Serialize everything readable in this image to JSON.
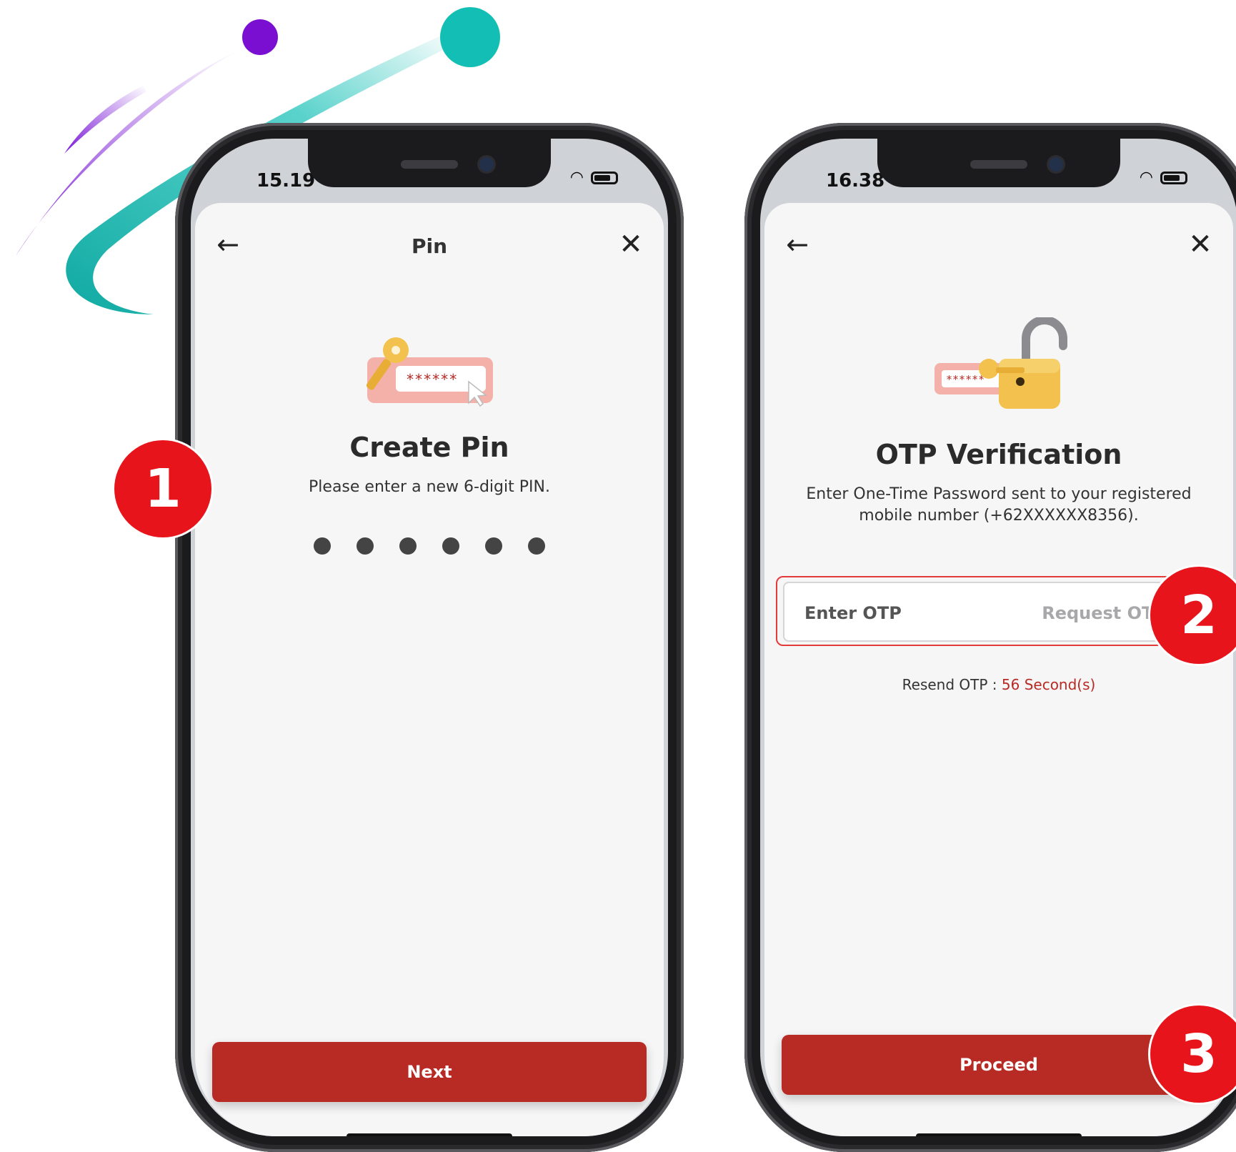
{
  "steps": [
    {
      "number": "1"
    },
    {
      "number": "2"
    },
    {
      "number": "3"
    }
  ],
  "colors": {
    "accent": "#b82a24",
    "step_badge": "#e8141c",
    "swoosh_teal": "#13bfb5",
    "swoosh_purple": "#7a18d6"
  },
  "left_phone": {
    "status_time": "15.19",
    "nav": {
      "title": "Pin",
      "back_icon": "arrow-left-icon",
      "close_icon": "close-icon"
    },
    "heading": "Create Pin",
    "subtitle": "Please enter a new 6-digit PIN.",
    "illustration_text": "******",
    "pin_length": 6,
    "next_label": "Next"
  },
  "right_phone": {
    "status_time": "16.38",
    "nav": {
      "back_icon": "arrow-left-icon",
      "close_icon": "close-icon"
    },
    "heading": "OTP Verification",
    "subtitle_line1": "Enter One-Time Password sent to your registered",
    "subtitle_line2": "mobile number (+62XXXXXX8356).",
    "illustration_text": "******",
    "otp_placeholder": "Enter OTP",
    "request_otp_label": "Request OTP",
    "resend_label": "Resend OTP : ",
    "resend_timer": "56 Second(s)",
    "proceed_label": "Proceed"
  }
}
